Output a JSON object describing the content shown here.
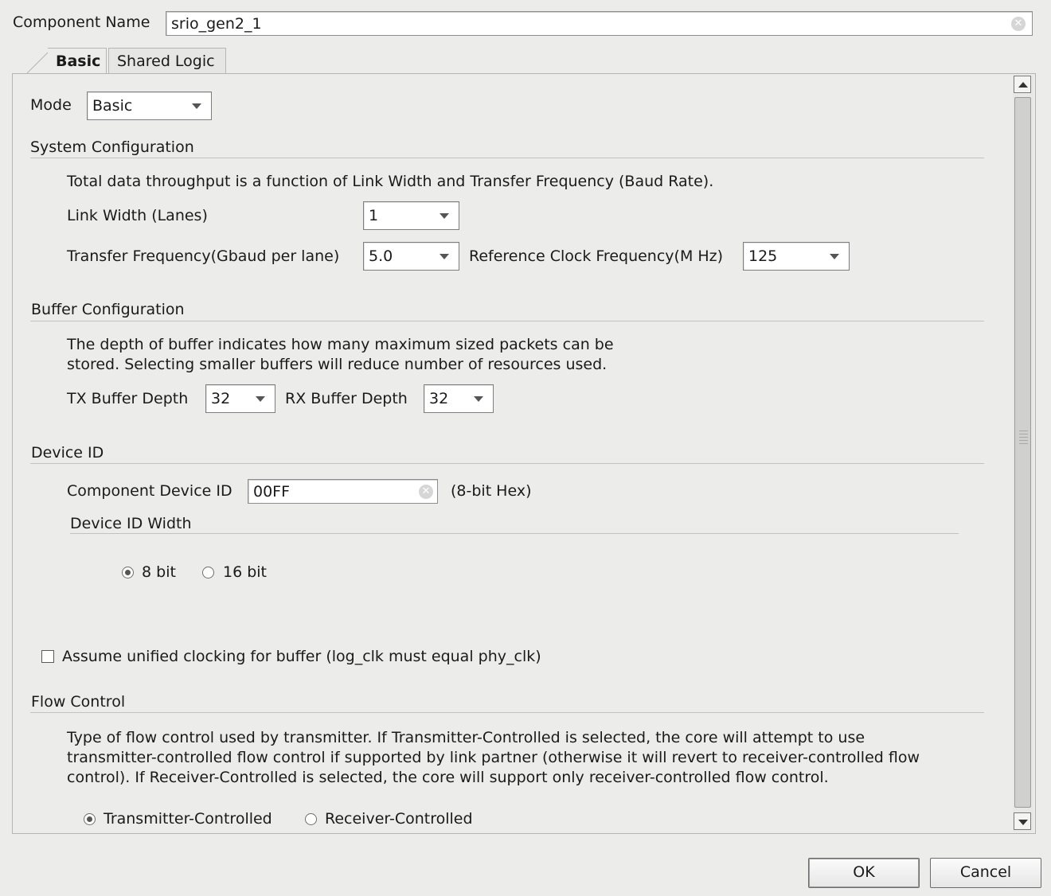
{
  "component": {
    "label": "Component Name",
    "value": "srio_gen2_1"
  },
  "tabs": [
    {
      "label": "Basic",
      "active": true
    },
    {
      "label": "Shared Logic",
      "active": false
    }
  ],
  "mode": {
    "label": "Mode",
    "value": "Basic"
  },
  "system_config": {
    "title": "System Configuration",
    "description": "Total data throughput is a function of Link Width and Transfer Frequency (Baud Rate).",
    "link_width": {
      "label": "Link Width (Lanes)",
      "value": "1"
    },
    "transfer_freq": {
      "label": "Transfer Frequency(Gbaud per lane)",
      "value": "5.0"
    },
    "ref_clock": {
      "label": "Reference Clock Frequency(M Hz)",
      "value": "125"
    }
  },
  "buffer_config": {
    "title": "Buffer Configuration",
    "description_line1": "The depth of buffer indicates how many maximum sized packets can be",
    "description_line2": "stored. Selecting smaller buffers will reduce number of resources used.",
    "tx": {
      "label": "TX Buffer Depth",
      "value": "32"
    },
    "rx": {
      "label": "RX Buffer Depth",
      "value": "32"
    }
  },
  "device_id": {
    "title": "Device ID",
    "component_device_id": {
      "label": "Component Device ID",
      "value": "00FF",
      "suffix": "(8-bit Hex)"
    },
    "width": {
      "title": "Device ID Width",
      "options": [
        {
          "label": "8 bit",
          "selected": true
        },
        {
          "label": "16 bit",
          "selected": false
        }
      ]
    }
  },
  "unified_clocking": {
    "label": "Assume unified clocking for buffer (log_clk must equal phy_clk)",
    "checked": false
  },
  "flow_control": {
    "title": "Flow Control",
    "line1": "Type of flow control used by transmitter. If Transmitter-Controlled is selected, the core will attempt to use",
    "line2": "transmitter-controlled flow control if supported by link partner (otherwise it will revert to receiver-controlled flow",
    "line3": "control). If Receiver-Controlled is selected, the core will support only receiver-controlled flow control.",
    "options": [
      {
        "label": "Transmitter-Controlled",
        "selected": true
      },
      {
        "label": "Receiver-Controlled",
        "selected": false
      }
    ]
  },
  "buttons": {
    "ok": "OK",
    "cancel": "Cancel"
  },
  "icons": {
    "clear": "clear-icon",
    "dropdown": "chevron-down-icon"
  }
}
